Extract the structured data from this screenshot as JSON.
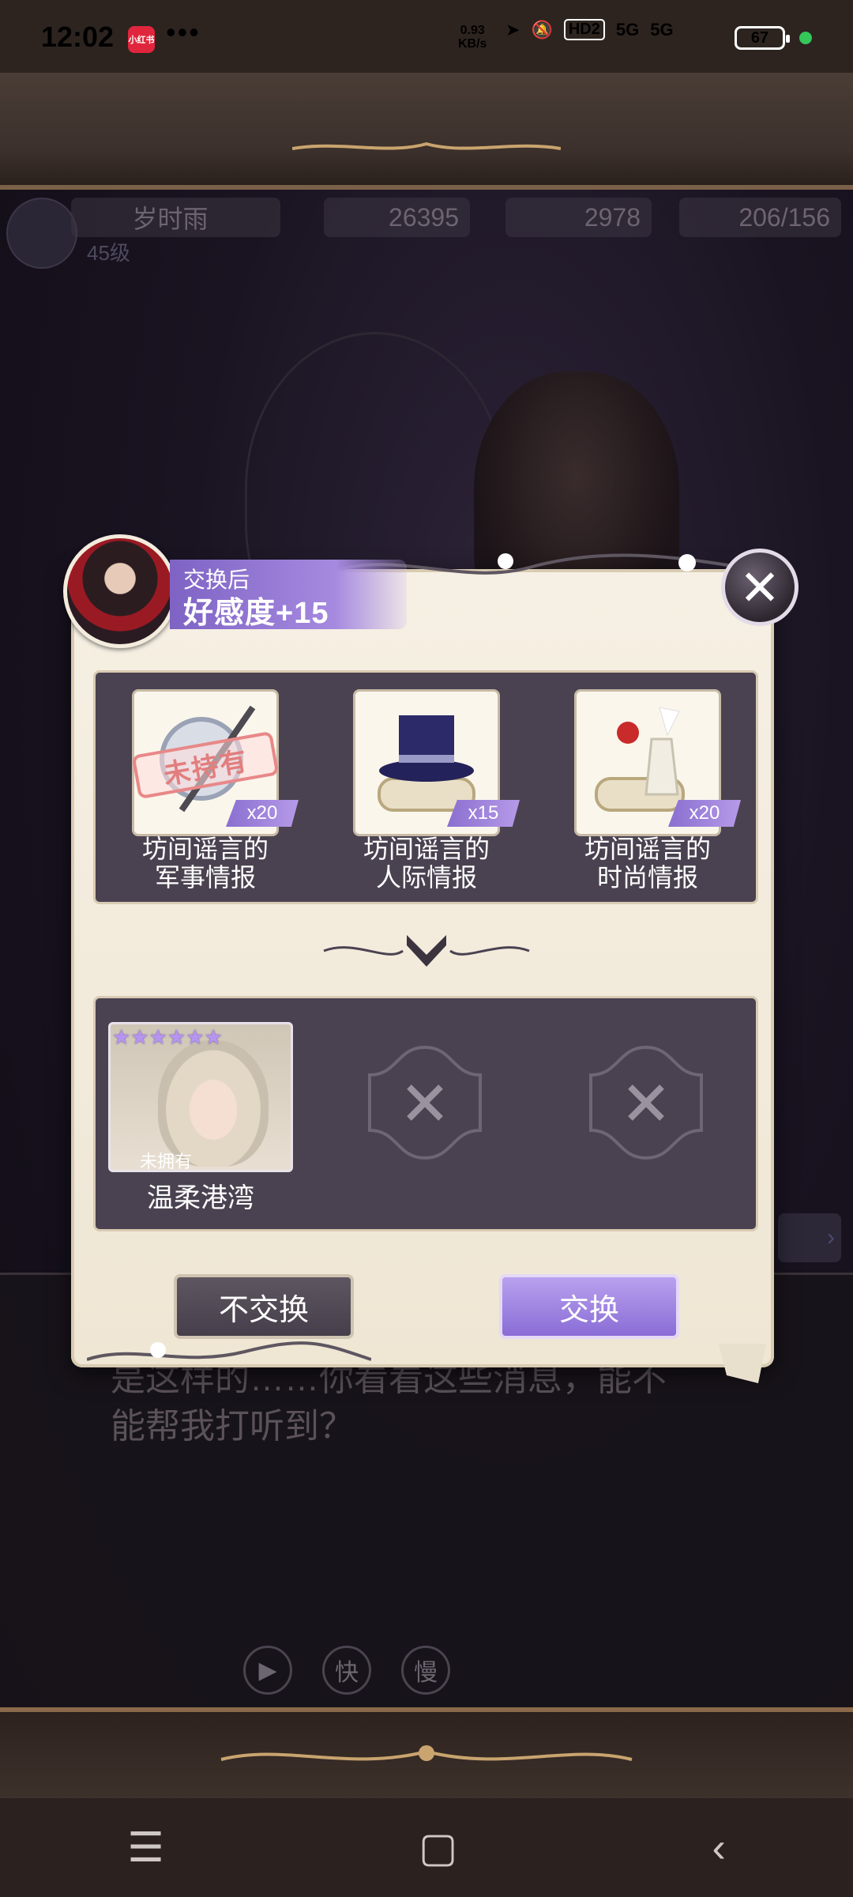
{
  "status_bar": {
    "time": "12:02",
    "app_badge": "小红书",
    "more": "•••",
    "speed_value": "0.93",
    "speed_unit": "KB/s",
    "hd_label": "HD2",
    "signal1": "5G",
    "signal2": "5G",
    "battery": "67"
  },
  "game_hud": {
    "player_name": "岁时雨",
    "level": "45级",
    "gold": "26395",
    "gems": "2978",
    "stamina": "206/156"
  },
  "dialog": {
    "text_line1": "是这样的……你看看这些消息，能不",
    "text_line2": "能帮我打听到？",
    "play_icon": "▶",
    "fast_label": "快",
    "slow_label": "慢"
  },
  "modal": {
    "badge_sub": "交换后",
    "badge_main": "好感度+15",
    "close_icon": "✕",
    "items": [
      {
        "name_line1": "坊间谣言的",
        "name_line2": "军事情报",
        "qty": "x20",
        "stamp": "未持有",
        "icon": "sword-shield-icon"
      },
      {
        "name_line1": "坊间谣言的",
        "name_line2": "人际情报",
        "qty": "x15",
        "icon": "top-hat-scroll-icon"
      },
      {
        "name_line1": "坊间谣言的",
        "name_line2": "时尚情报",
        "qty": "x20",
        "icon": "flower-vase-scroll-icon"
      }
    ],
    "result_card": {
      "name": "温柔港湾",
      "status": "未拥有",
      "stars": "★★★★★★"
    },
    "empty_slot_icon": "✕",
    "decline_label": "不交换",
    "confirm_label": "交换"
  },
  "nav": {
    "menu": "☰",
    "home": "▢",
    "back": "‹"
  },
  "colors": {
    "accent": "#9a7fe0",
    "panel": "#4a4250",
    "paper": "#f4eee2"
  }
}
